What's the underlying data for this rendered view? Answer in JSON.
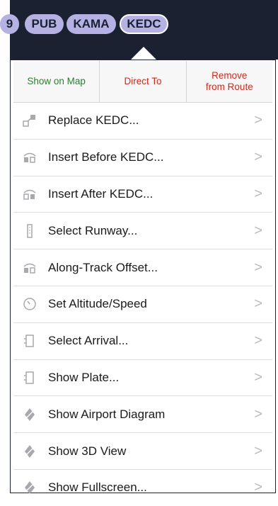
{
  "route_bar": {
    "waypoints": [
      "9",
      "PUB",
      "KAMA",
      "KEDC"
    ],
    "selected": "KEDC"
  },
  "toolbar": {
    "show_on_map": "Show on Map",
    "direct_to": "Direct To",
    "remove_from_route_line1": "Remove",
    "remove_from_route_line2": "from Route"
  },
  "menu": {
    "items": [
      {
        "label": "Replace KEDC...",
        "icon": "replace-icon"
      },
      {
        "label": "Insert Before KEDC...",
        "icon": "insert-before-icon"
      },
      {
        "label": "Insert After KEDC...",
        "icon": "insert-after-icon"
      },
      {
        "label": "Select Runway...",
        "icon": "runway-icon"
      },
      {
        "label": "Along-Track Offset...",
        "icon": "offset-icon"
      },
      {
        "label": "Set Altitude/Speed",
        "icon": "clock-icon"
      },
      {
        "label": "Select Arrival...",
        "icon": "arrival-icon"
      },
      {
        "label": "Show Plate...",
        "icon": "plate-icon"
      },
      {
        "label": "Show Airport Diagram",
        "icon": "airport-diagram-icon"
      },
      {
        "label": "Show 3D View",
        "icon": "3d-view-icon"
      },
      {
        "label": "Show Fullscreen...",
        "icon": "fullscreen-icon"
      }
    ],
    "chevron": ">"
  },
  "colors": {
    "topbar": "#1b2131",
    "chip": "#b5b2e3",
    "green": "#2e7d32",
    "red": "#cc2b1d"
  }
}
